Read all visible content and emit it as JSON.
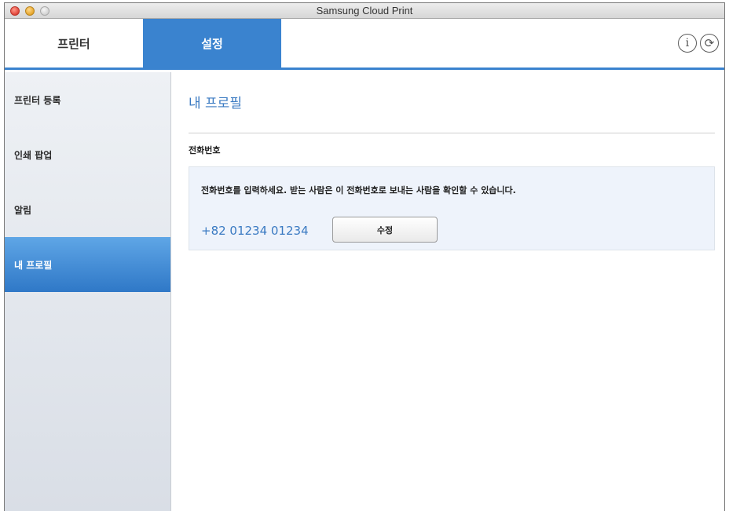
{
  "window": {
    "title": "Samsung Cloud Print"
  },
  "tabs": {
    "printer": "프린터",
    "settings": "설정"
  },
  "toolbar": {
    "info_glyph": "i",
    "refresh_glyph": "⟳"
  },
  "sidebar": {
    "items": [
      {
        "label": "프린터 등록"
      },
      {
        "label": "인쇄 팝업"
      },
      {
        "label": "알림"
      },
      {
        "label": "내 프로필"
      }
    ]
  },
  "main": {
    "title": "내 프로필",
    "section_label": "전화번호",
    "description": "전화번호를 입력하세요. 받는 사람은 이 전화번호로 보내는 사람을 확인할 수 있습니다.",
    "phone_number": "+82 01234 01234",
    "edit_button": "수정"
  }
}
